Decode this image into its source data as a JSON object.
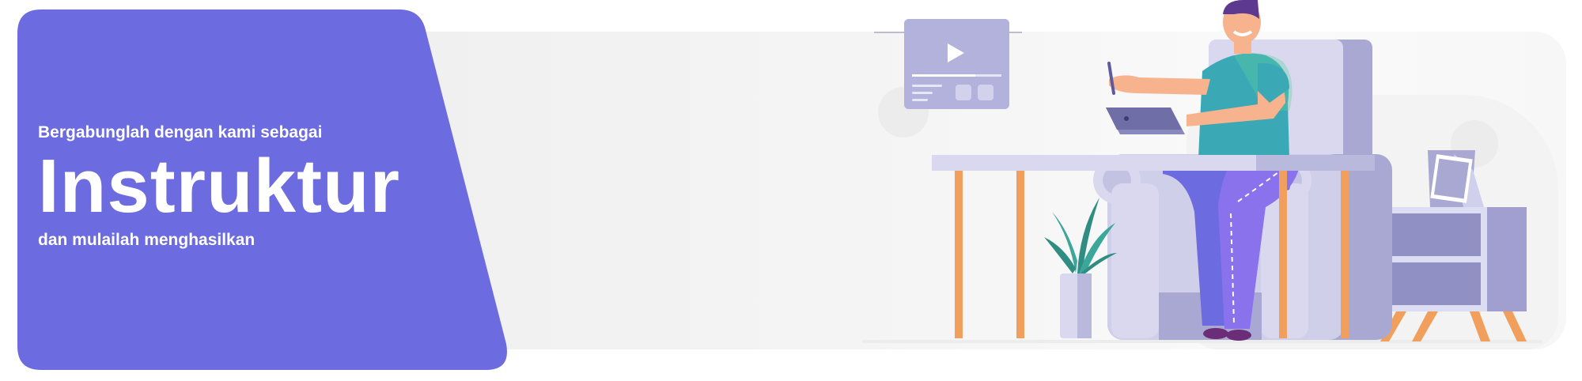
{
  "banner": {
    "eyebrow": "Bergabunglah dengan kami sebagai",
    "title": "Instruktur",
    "subtitle": "dan mulailah menghasilkan"
  },
  "colors": {
    "accent_purple": "#6c6be0",
    "chair": "#d9d8ee",
    "chair_shadow": "#a9a8d3",
    "desk_leg": "#f0a05c",
    "shirt": "#3ba9b5",
    "pants": "#7b6fe0",
    "plant": "#3aa79a"
  },
  "icons": {
    "video_card": "play-icon"
  }
}
